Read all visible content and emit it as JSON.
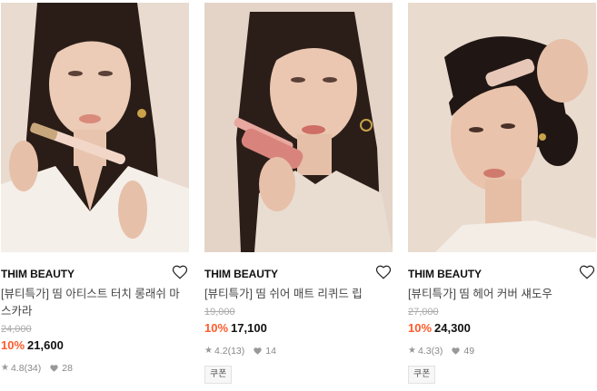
{
  "products": [
    {
      "brand": "THIM BEAUTY",
      "title": "[뷰티특가] 띰 아티스트 터치 롱래쉬 마스카라",
      "original_price": "24,000",
      "discount": "10%",
      "price": "21,600",
      "rating": "4.8",
      "reviews": "(34)",
      "likes": "28",
      "coupon": ""
    },
    {
      "brand": "THIM BEAUTY",
      "title": "[뷰티특가] 띰 쉬어 매트 리퀴드 립",
      "original_price": "19,000",
      "discount": "10%",
      "price": "17,100",
      "rating": "4.2",
      "reviews": "(13)",
      "likes": "14",
      "coupon": "쿠폰"
    },
    {
      "brand": "THIM BEAUTY",
      "title": "[뷰티특가] 띰 헤어 커버 섀도우",
      "original_price": "27,000",
      "discount": "10%",
      "price": "24,300",
      "rating": "4.3",
      "reviews": "(3)",
      "likes": "49",
      "coupon": "쿠폰"
    }
  ],
  "icons": {
    "wishlist": "heart-outline-icon",
    "rating": "star-icon",
    "likes": "heart-filled-icon"
  },
  "colors": {
    "discount": "#ff5a2c",
    "background": "#ffffff",
    "original_price": "#aaaaaa"
  }
}
